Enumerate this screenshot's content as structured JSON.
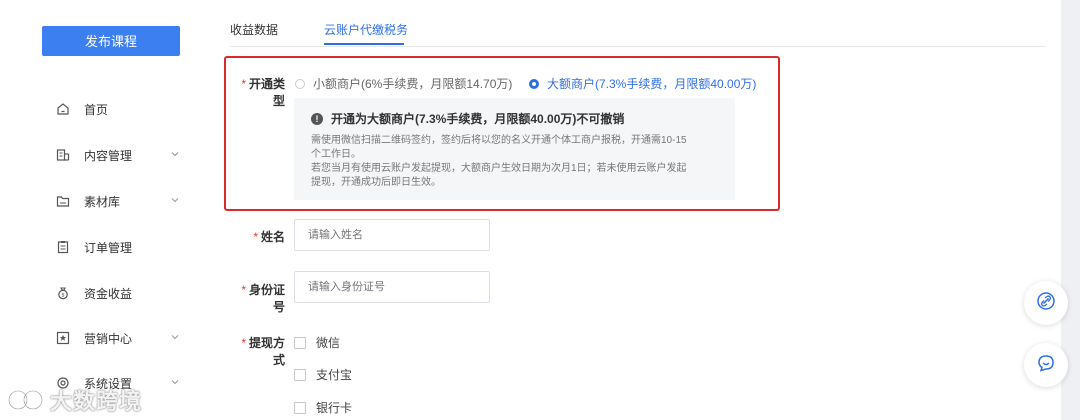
{
  "sidebar": {
    "publish_button": "发布课程",
    "items": [
      {
        "label": "首页",
        "icon": "home-icon",
        "has_chevron": false
      },
      {
        "label": "内容管理",
        "icon": "content-icon",
        "has_chevron": true
      },
      {
        "label": "素材库",
        "icon": "folder-icon",
        "has_chevron": true
      },
      {
        "label": "订单管理",
        "icon": "clipboard-icon",
        "has_chevron": false
      },
      {
        "label": "资金收益",
        "icon": "money-bag-icon",
        "has_chevron": false
      },
      {
        "label": "营销中心",
        "icon": "star-icon",
        "has_chevron": true
      },
      {
        "label": "系统设置",
        "icon": "gear-icon",
        "has_chevron": true
      }
    ]
  },
  "tabs": [
    {
      "label": "收益数据",
      "active": false
    },
    {
      "label": "云账户代缴税务",
      "active": true
    }
  ],
  "form": {
    "account_type": {
      "label": "开通类型",
      "options": [
        {
          "label": "小额商户(6%手续费，月限额14.70万)",
          "checked": false
        },
        {
          "label": "大额商户(7.3%手续费，月限额40.00万)",
          "checked": true
        }
      ],
      "notice_title": "开通为大额商户(7.3%手续费，月限额40.00万)不可撤销",
      "notice_lines": [
        "需使用微信扫描二维码签约，签约后将以您的名义开通个体工商户报税，开通需10-15",
        "个工作日。",
        "若您当月有使用云账户发起提现，大额商户生效日期为次月1日；若未使用云账户发起",
        "提现，开通成功后即日生效。"
      ]
    },
    "name": {
      "label": "姓名",
      "placeholder": "请输入姓名"
    },
    "id_number": {
      "label": "身份证号",
      "placeholder": "请输入身份证号"
    },
    "withdraw": {
      "label": "提现方式",
      "options": [
        "微信",
        "支付宝",
        "银行卡"
      ]
    }
  },
  "watermark": "大数跨境",
  "colors": {
    "accent": "#2f6fe6",
    "button": "#3b7ff0",
    "highlight": "#d92b2b"
  }
}
